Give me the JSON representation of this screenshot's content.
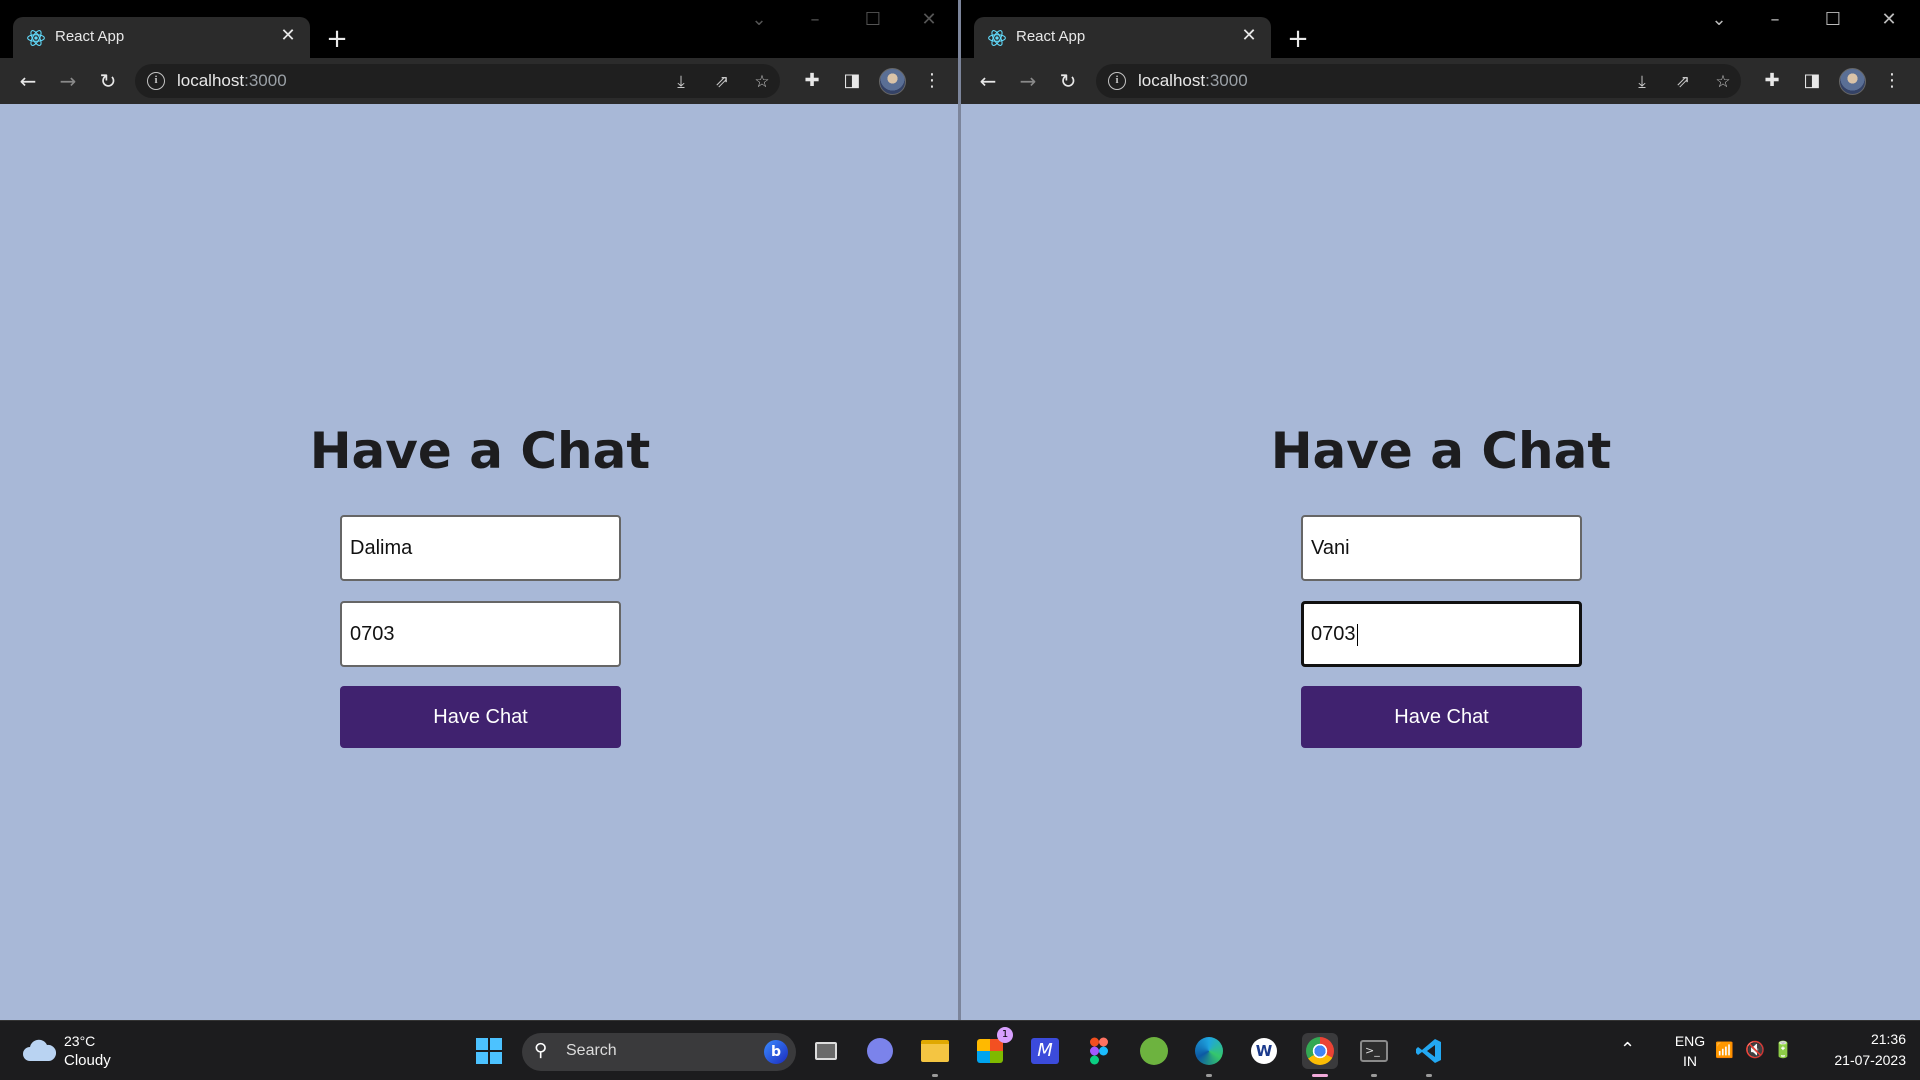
{
  "windows": [
    {
      "id": "left",
      "tab_title": "React App",
      "url_host": "localhost",
      "url_port": ":3000",
      "heading": "Have a Chat",
      "name_value": "Dalima",
      "room_value": "0703",
      "button_label": "Have Chat",
      "focused_field": "none"
    },
    {
      "id": "right",
      "tab_title": "React App",
      "url_host": "localhost",
      "url_port": ":3000",
      "heading": "Have a Chat",
      "name_value": "Vani",
      "room_value": "0703",
      "button_label": "Have Chat",
      "focused_field": "room"
    }
  ],
  "taskbar": {
    "weather_temp": "23°C",
    "weather_condition": "Cloudy",
    "search_label": "Search",
    "store_badge": "1",
    "language_line1": "ENG",
    "language_line2": "IN",
    "time": "21:36",
    "date": "21-07-2023"
  },
  "colors": {
    "page_background": "#a8b8d7",
    "button_background": "#40226f",
    "heading_text": "#1d1d1f"
  }
}
